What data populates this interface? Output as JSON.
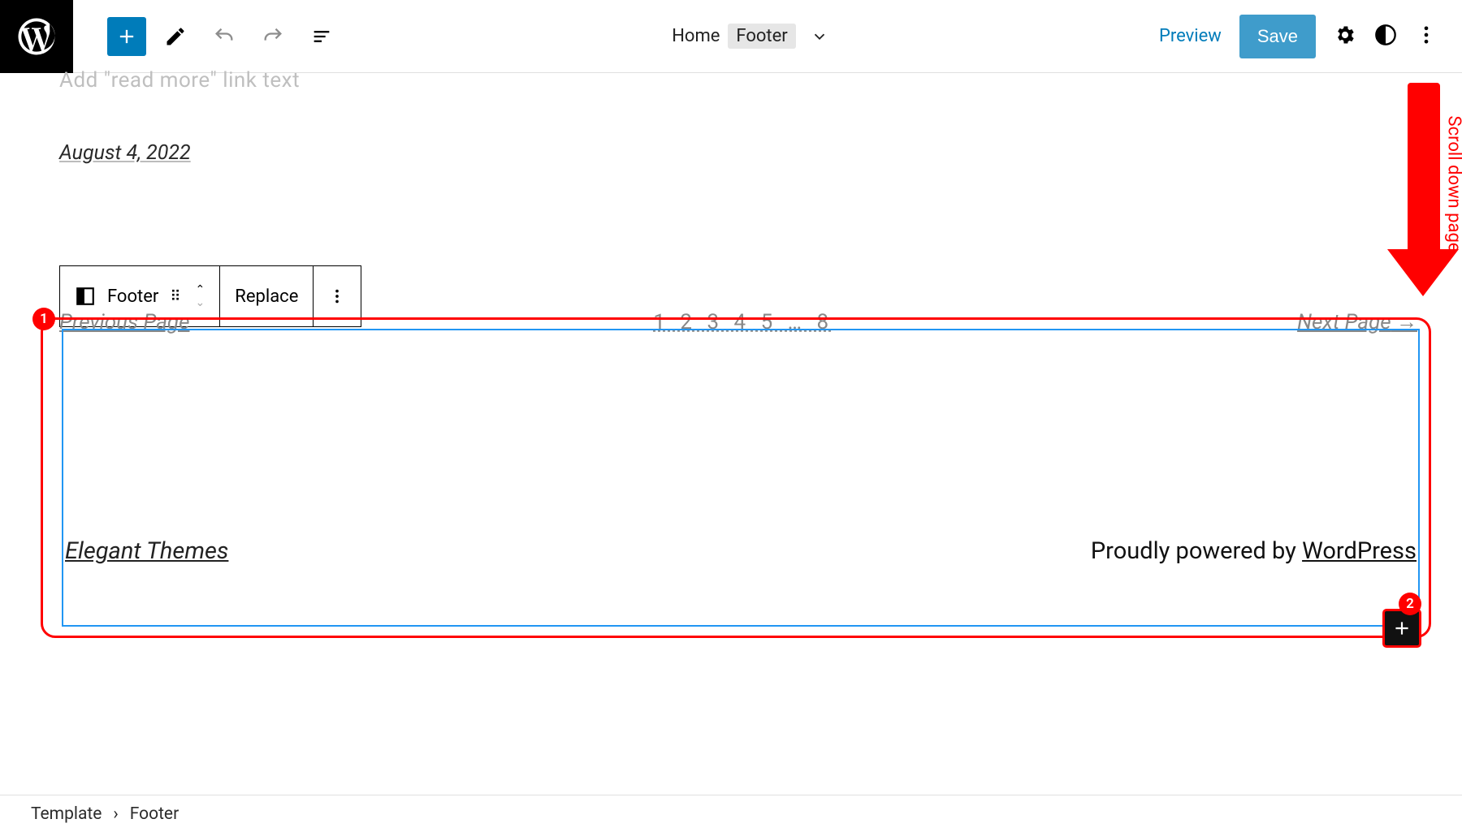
{
  "topbar": {
    "home_label": "Home",
    "template_part_label": "Footer",
    "preview_label": "Preview",
    "save_label": "Save"
  },
  "canvas": {
    "readmore_placeholder": "Add \"read more\" link text",
    "post_date": "August 4, 2022",
    "pagination": {
      "prev_label": "Previous Page",
      "numbers": "1 2 3 4 5 … 8",
      "next_label": "Next Page",
      "next_arrow": "→"
    }
  },
  "block_toolbar": {
    "label": "Footer",
    "replace_label": "Replace"
  },
  "footer": {
    "site_title": "Elegant Themes",
    "powered_prefix": "Proudly powered by ",
    "powered_link": "WordPress"
  },
  "annotations": {
    "badge_1": "1",
    "badge_2": "2",
    "scroll_label": "Scroll down page"
  },
  "breadcrumb": {
    "root": "Template",
    "current": "Footer"
  }
}
